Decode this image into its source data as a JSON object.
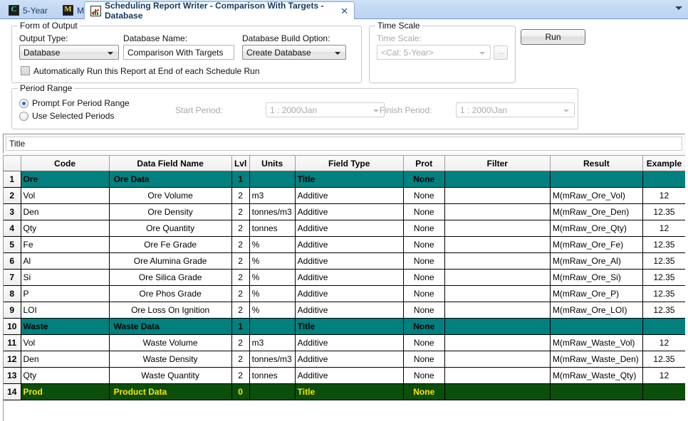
{
  "window": {
    "tabs": [
      {
        "label": "5-Year",
        "icon": "calendar-c-icon",
        "active": false,
        "closable": false
      },
      {
        "label": "Main",
        "icon": "main-m-icon",
        "active": false,
        "closable": false
      },
      {
        "label": "Scheduling Report Writer - Comparison With Targets - Database",
        "icon": "report-chart-icon",
        "active": true,
        "closable": true
      }
    ],
    "tab_close_glyph": "✕",
    "tab_menu_icon": "chevron-down-icon"
  },
  "form_of_output": {
    "legend": "Form of Output",
    "output_type_label": "Output Type:",
    "output_type_value": "Database",
    "database_name_label": "Database Name:",
    "database_name_value": "Comparison With Targets",
    "build_option_label": "Database Build Option:",
    "build_option_value": "Create Database",
    "auto_run_label": "Automatically Run this Report at End of each Schedule Run",
    "auto_run_checked": false
  },
  "time_scale": {
    "legend": "Time Scale",
    "label": "Time Scale:",
    "value": "<Cal: 5-Year>",
    "browse_label": "...",
    "disabled": true
  },
  "run_button": {
    "label": "Run"
  },
  "period_range": {
    "legend": "Period Range",
    "options": [
      {
        "label": "Prompt For Period Range",
        "selected": true
      },
      {
        "label": "Use Selected Periods",
        "selected": false
      }
    ],
    "start_period_label": "Start Period:",
    "start_period_value": "1 : 2000\\Jan",
    "finish_period_label": "Finish Period:",
    "finish_period_value": "1 : 2000\\Jan",
    "disabled": true
  },
  "title_field": {
    "value": "Title"
  },
  "grid": {
    "columns": [
      "",
      "Code",
      "Data Field Name",
      "Lvl",
      "Units",
      "Field Type",
      "Prot",
      "Filter",
      "Result",
      "Example"
    ],
    "rows": [
      {
        "n": "1",
        "style": "group-teal",
        "code": "Ore",
        "name": "Ore Data",
        "lvl": "1",
        "units": "",
        "ftype": "Title",
        "prot": "None",
        "filter": "",
        "result": "",
        "example": ""
      },
      {
        "n": "2",
        "style": "data",
        "code": "Vol",
        "name": "Ore Volume",
        "lvl": "2",
        "units": "m3",
        "ftype": "Additive",
        "prot": "None",
        "filter": "",
        "result": "M(mRaw_Ore_Vol)",
        "example": "12"
      },
      {
        "n": "3",
        "style": "data",
        "code": "Den",
        "name": "Ore Density",
        "lvl": "2",
        "units": "tonnes/m3",
        "ftype": "Additive",
        "prot": "None",
        "filter": "",
        "result": "M(mRaw_Ore_Den)",
        "example": "12.35"
      },
      {
        "n": "4",
        "style": "data",
        "code": "Qty",
        "name": "Ore Quantity",
        "lvl": "2",
        "units": "tonnes",
        "ftype": "Additive",
        "prot": "None",
        "filter": "",
        "result": "M(mRaw_Ore_Qty)",
        "example": "12"
      },
      {
        "n": "5",
        "style": "data",
        "code": "Fe",
        "name": "Ore Fe Grade",
        "lvl": "2",
        "units": "%",
        "ftype": "Additive",
        "prot": "None",
        "filter": "",
        "result": "M(mRaw_Ore_Fe)",
        "example": "12.35"
      },
      {
        "n": "6",
        "style": "data",
        "code": "Al",
        "name": "Ore Alumina Grade",
        "lvl": "2",
        "units": "%",
        "ftype": "Additive",
        "prot": "None",
        "filter": "",
        "result": "M(mRaw_Ore_Al)",
        "example": "12.35"
      },
      {
        "n": "7",
        "style": "data",
        "code": "Si",
        "name": "Ore Silica Grade",
        "lvl": "2",
        "units": "%",
        "ftype": "Additive",
        "prot": "None",
        "filter": "",
        "result": "M(mRaw_Ore_Si)",
        "example": "12.35"
      },
      {
        "n": "8",
        "style": "data",
        "code": "P",
        "name": "Ore Phos Grade",
        "lvl": "2",
        "units": "%",
        "ftype": "Additive",
        "prot": "None",
        "filter": "",
        "result": "M(mRaw_Ore_P)",
        "example": "12.35"
      },
      {
        "n": "9",
        "style": "data",
        "code": "LOI",
        "name": "Ore Loss On Ignition",
        "lvl": "2",
        "units": "%",
        "ftype": "Additive",
        "prot": "None",
        "filter": "",
        "result": "M(mRaw_Ore_LOI)",
        "example": "12.35"
      },
      {
        "n": "10",
        "style": "group-teal",
        "code": "Waste",
        "name": "Waste Data",
        "lvl": "1",
        "units": "",
        "ftype": "Title",
        "prot": "None",
        "filter": "",
        "result": "",
        "example": ""
      },
      {
        "n": "11",
        "style": "data",
        "code": "Vol",
        "name": "Waste Volume",
        "lvl": "2",
        "units": "m3",
        "ftype": "Additive",
        "prot": "None",
        "filter": "",
        "result": "M(mRaw_Waste_Vol)",
        "example": "12"
      },
      {
        "n": "12",
        "style": "data",
        "code": "Den",
        "name": "Waste Density",
        "lvl": "2",
        "units": "tonnes/m3",
        "ftype": "Additive",
        "prot": "None",
        "filter": "",
        "result": "M(mRaw_Waste_Den)",
        "example": "12.35"
      },
      {
        "n": "13",
        "style": "data",
        "code": "Qty",
        "name": "Waste Quantity",
        "lvl": "2",
        "units": "tonnes",
        "ftype": "Additive",
        "prot": "None",
        "filter": "",
        "result": "M(mRaw_Waste_Qty)",
        "example": "12"
      },
      {
        "n": "14",
        "style": "group-green",
        "code": "Prod",
        "name": "Product Data",
        "lvl": "0",
        "units": "",
        "ftype": "Title",
        "prot": "None",
        "filter": "",
        "result": "",
        "example": ""
      }
    ]
  },
  "colors": {
    "group_teal": "#00807f",
    "group_green": "#0b4f0b",
    "group_green_text": "#ffe500",
    "tabstrip": "#c3d8f3",
    "accent_text": "#12395f"
  }
}
